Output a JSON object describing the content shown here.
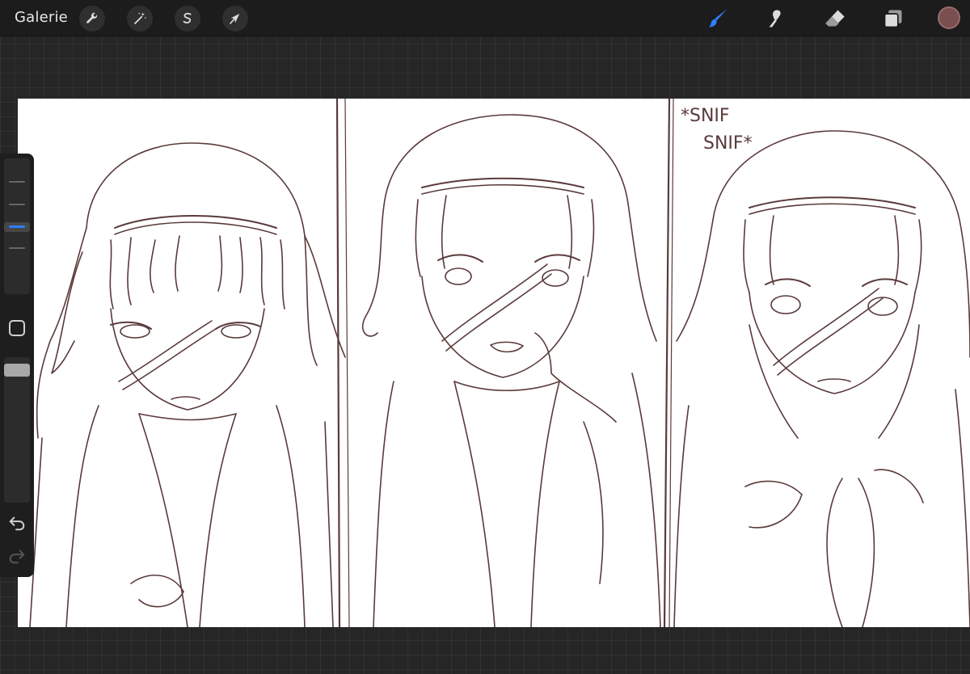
{
  "topbar": {
    "gallery_label": "Galerie",
    "left_tools": [
      "wrench-icon",
      "magic-wand-icon",
      "selection-icon",
      "transform-icon"
    ],
    "right_tools": [
      "brush-icon",
      "smudge-icon",
      "eraser-icon",
      "layers-icon"
    ],
    "active_tool": "brush",
    "accent_color": "#2f7fff",
    "current_color": "#7a4f4f"
  },
  "canvas": {
    "sfx_line1": "*SNIF",
    "sfx_line2": "SNIF*",
    "line_color": "#5a3a3a"
  },
  "sidebar": {
    "tools": [
      "brush-size-slider",
      "modify-button",
      "opacity-slider",
      "undo-icon",
      "redo-icon"
    ]
  }
}
